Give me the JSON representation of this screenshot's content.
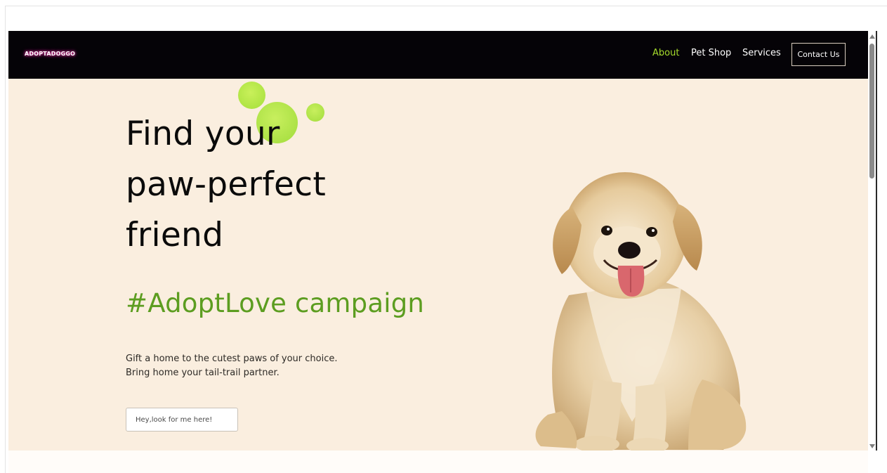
{
  "nav": {
    "logo": "ADOPTADOGGO",
    "links": [
      "About",
      "Pet Shop",
      "Services"
    ],
    "active_link": "About",
    "contact_label": "Contact Us"
  },
  "hero": {
    "title_lines": [
      "Find your",
      "paw-perfect",
      "friend"
    ],
    "campaign": "#AdoptLove campaign",
    "description_lines": [
      "Gift a home to the cutest paws of your choice.",
      "Bring home your tail-trail partner."
    ],
    "search_placeholder": "Hey,look for me here!"
  },
  "images": {
    "hero_image": "puppy-illustration"
  },
  "colors": {
    "navbar_bg": "#050307",
    "hero_bg": "#faeedf",
    "accent_green": "#a6dd2c",
    "campaign_green": "#5c9d20"
  }
}
